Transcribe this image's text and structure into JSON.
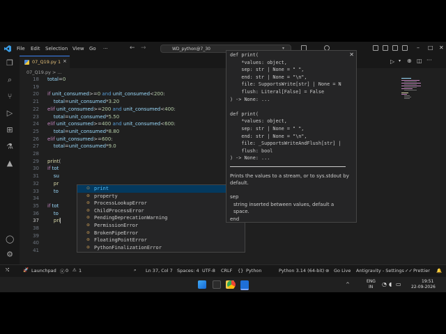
{
  "titlebar": {
    "menu": [
      "File",
      "Edit",
      "Selection",
      "View",
      "Go",
      "···"
    ],
    "search": "WD_python@7_30"
  },
  "tab": {
    "label": "07_Q19.py 1"
  },
  "breadcrumb": "07_Q19.py > ...",
  "editor": {
    "lines": [
      {
        "n": "18",
        "code": "total=0"
      },
      {
        "n": "19",
        "code": ""
      },
      {
        "n": "20",
        "code": "if unit_consumed>=0 and unit_consumed<200:"
      },
      {
        "n": "21",
        "code": "    total=unit_consumed*3.20"
      },
      {
        "n": "22",
        "code": "elif unit_consumed>=200 and unit_consumed<400:"
      },
      {
        "n": "23",
        "code": "    total=unit_consumed*5.50"
      },
      {
        "n": "24",
        "code": "elif unit_consumed>=400 and unit_consumed<600:"
      },
      {
        "n": "25",
        "code": "    total=unit_consumed*8.80"
      },
      {
        "n": "26",
        "code": "elif unit_consumed>=600:"
      },
      {
        "n": "27",
        "code": "    total=unit_consumed*9.0"
      },
      {
        "n": "28",
        "code": ""
      },
      {
        "n": "29",
        "code": "print("
      },
      {
        "n": "30",
        "code": "if tot"
      },
      {
        "n": "31",
        "code": "    su"
      },
      {
        "n": "32",
        "code": "    pr"
      },
      {
        "n": "33",
        "code": "    to"
      },
      {
        "n": "34",
        "code": ""
      },
      {
        "n": "35",
        "code": "if tot"
      },
      {
        "n": "36",
        "code": "    to"
      },
      {
        "n": "37",
        "code": "    pri"
      },
      {
        "n": "38",
        "code": ""
      },
      {
        "n": "39",
        "code": ""
      },
      {
        "n": "40",
        "code": ""
      },
      {
        "n": "41",
        "code": ""
      }
    ]
  },
  "suggest": [
    "print",
    "property",
    "ProcessLookupError",
    "ChildProcessError",
    "PendingDeprecationWarning",
    "PermissionError",
    "BrokenPipeError",
    "FloatingPointError",
    "PythonFinalizationError"
  ],
  "hover": {
    "sig1": [
      "def print(",
      "    *values: object,",
      "    sep: str | None = \" \",",
      "    end: str | None = \"\\n\",",
      "    file: SupportsWrite[str] | None = N",
      "    flush: Literal[False] = False",
      ") -> None: ..."
    ],
    "sig2": [
      "def print(",
      "    *values: object,",
      "    sep: str | None = \" \",",
      "    end: str | None = \"\\n\",",
      "    file: _SupportsWriteAndFlush[str] |",
      "    flush: bool",
      ") -> None: ..."
    ],
    "doc": "Prints the values to a stream, or to sys.stdout by default.",
    "param": "sep",
    "param_doc": "string inserted between values, default a space.",
    "more": "end"
  },
  "status": {
    "launchpad": "Launchpad",
    "errors": "0",
    "warnings": "1",
    "position": "Ln 37, Col 7",
    "spaces": "Spaces: 4",
    "encoding": "UTF-8",
    "eol": "CRLF",
    "language": "Python",
    "interpreter": "Python 3.14 (64-bit)",
    "golive": "Go Live",
    "antigravity": "Antigravity - Settings",
    "prettier": "Prettier"
  },
  "taskbar": {
    "lang1": "ENG",
    "lang2": "IN",
    "time": "19:51",
    "date": "22-09-2026"
  }
}
